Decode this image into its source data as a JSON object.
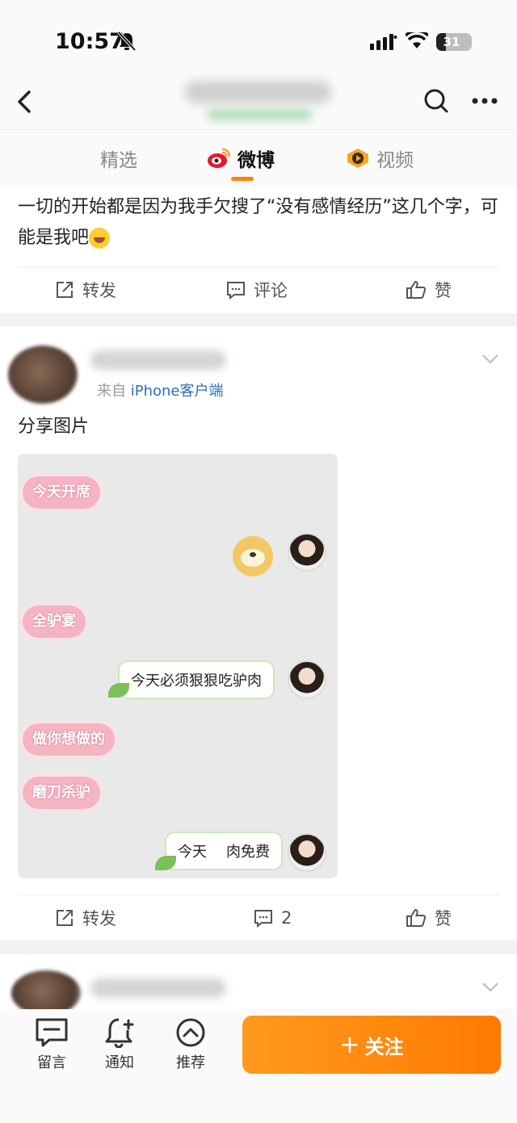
{
  "status_bar": {
    "time": "10:57",
    "battery": "31"
  },
  "nav": {
    "back_icon": "chevron-left-icon",
    "search_icon": "search-icon",
    "more_icon": "more-icon"
  },
  "tabs": [
    {
      "label": "精选"
    },
    {
      "label": "微博",
      "icon": "weibo-logo-icon"
    },
    {
      "label": "视频",
      "icon": "video-icon"
    }
  ],
  "post1": {
    "text": "一切的开始都是因为我手欠搜了“没有感情经历”这几个字，可能是我",
    "text_tail": "吧",
    "actions": {
      "forward": "转发",
      "comment": "评论",
      "like": "赞"
    }
  },
  "post2": {
    "source_text": "来自",
    "source_client": "iPhone客户端",
    "text": "分享图片",
    "image": {
      "pills": [
        "今天开席",
        "全驴宴",
        "做你想做的",
        "磨刀杀驴"
      ],
      "bubbles": [
        "今天必须狠狠吃驴肉",
        "今天",
        "肉免费"
      ]
    },
    "actions": {
      "forward": "转发",
      "comment_count": "2",
      "like": "赞"
    }
  },
  "bottom_bar": {
    "message": "留言",
    "notify": "通知",
    "recommend": "推荐",
    "follow": "关注",
    "follow_prefix": "+"
  },
  "colors": {
    "accent": "#ff8200",
    "link": "#2f6fb7"
  }
}
